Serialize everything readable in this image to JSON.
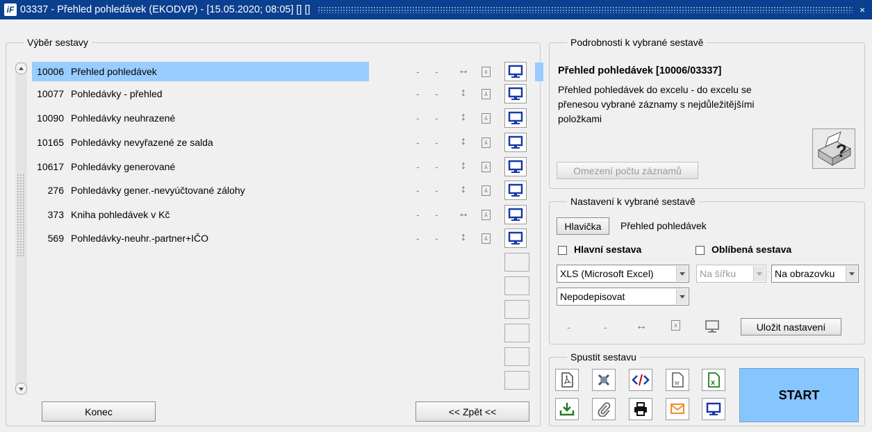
{
  "window": {
    "title": "03337 - Přehled pohledávek (EKODVP) - [15.05.2020; 08:05] [] []",
    "close_glyph": "×",
    "logo": "iF"
  },
  "left_group": {
    "legend": "Výběr sestavy"
  },
  "reports": [
    {
      "num": "10006",
      "name": "Přehled pohledávek",
      "d1": "-",
      "d2": "-",
      "arrow": "↔",
      "doc": "x"
    },
    {
      "num": "10077",
      "name": "Pohledávky - přehled",
      "d1": "-",
      "d2": "-",
      "arrow": "↕",
      "doc": "⅄"
    },
    {
      "num": "10090",
      "name": "Pohledávky neuhrazené",
      "d1": "-",
      "d2": "-",
      "arrow": "↕",
      "doc": "⅄"
    },
    {
      "num": "10165",
      "name": "Pohledávky nevyřazené ze salda",
      "d1": "-",
      "d2": "-",
      "arrow": "↕",
      "doc": "⅄"
    },
    {
      "num": "10617",
      "name": "Pohledávky generované",
      "d1": "-",
      "d2": "-",
      "arrow": "↕",
      "doc": "⅄"
    },
    {
      "num": "276",
      "name": "Pohledávky gener.-nevyúčtované zálohy",
      "d1": "-",
      "d2": "-",
      "arrow": "↕",
      "doc": "⅄"
    },
    {
      "num": "373",
      "name": "Kniha pohledávek v Kč",
      "d1": "-",
      "d2": "-",
      "arrow": "↔",
      "doc": "⅄"
    },
    {
      "num": "569",
      "name": "Pohledávky-neuhr.-partner+IČO",
      "d1": "-",
      "d2": "-",
      "arrow": "↕",
      "doc": "⅄"
    }
  ],
  "buttons": {
    "konec": "Konec",
    "zpet": "<< Zpět <<"
  },
  "details": {
    "legend": "Podrobnosti k vybrané sestavě",
    "title": "Přehled pohledávek [10006/03337]",
    "desc_l1": "Přehled pohledávek do excelu - do excelu se",
    "desc_l2": "přenesou vybrané záznamy s nejdůležitějšími",
    "desc_l3": "položkami",
    "limit_button": "Omezení počtu záznamů"
  },
  "settings": {
    "legend": "Nastavení k vybrané sestavě",
    "header_button": "Hlavička",
    "header_value": "Přehled pohledávek",
    "main_report_label": "Hlavní sestava",
    "favorite_label": "Oblíbená sestava",
    "format_select": "XLS (Microsoft Excel)",
    "orientation_select": "Na šířku",
    "output_select": "Na obrazovku",
    "sign_select": "Nepodepisovat",
    "d1": "-",
    "d2": "-",
    "arrow": "↔",
    "save_button": "Uložit nastavení"
  },
  "run": {
    "legend": "Spustit sestavu",
    "start": "START"
  },
  "colors": {
    "titlebar": "#0b3f8f",
    "selection": "#99ccff",
    "start": "#87c5ff",
    "monitor": "#1838a8"
  }
}
